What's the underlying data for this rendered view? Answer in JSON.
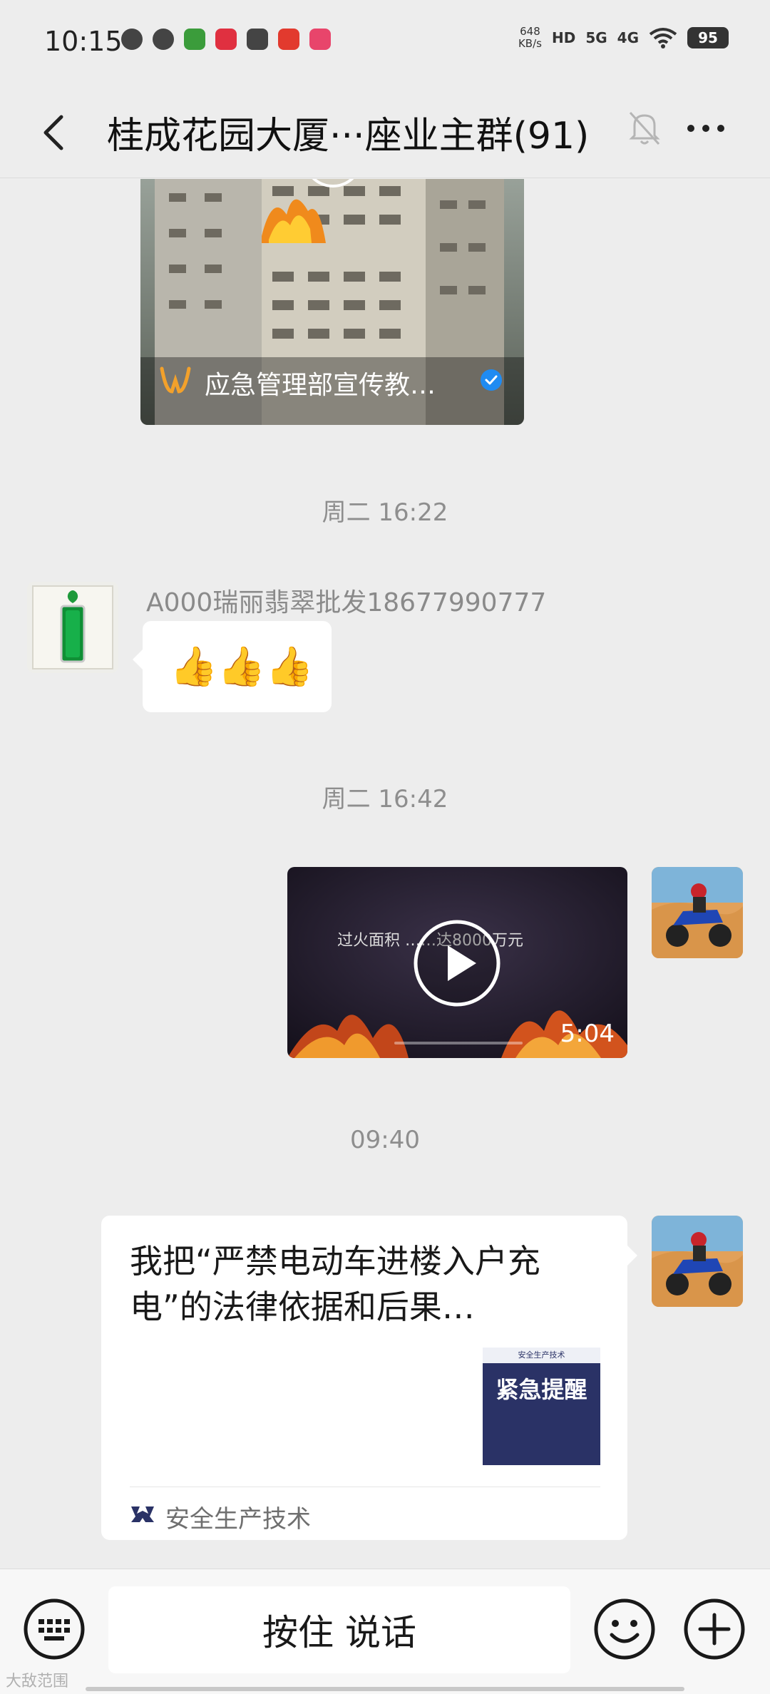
{
  "status_bar": {
    "time": "10:15",
    "net_speed_value": "648",
    "net_speed_unit": "KB/s",
    "hd_label": "HD",
    "signal_5g": "5G",
    "signal_4g": "4G",
    "battery": "95"
  },
  "header": {
    "title": "桂成花园大厦···座业主群(91)",
    "back_icon": "chevron-left-icon",
    "mute_icon": "bell-off-icon",
    "more_icon": "more-dots-icon"
  },
  "messages": {
    "top_image": {
      "channel_label": "应急管理部宣传教…"
    },
    "time_1": "周二 16:22",
    "msg_1": {
      "sender": "A000瑞丽翡翠批发18677990777",
      "content": "👍👍👍"
    },
    "time_2": "周二 16:42",
    "video": {
      "duration": "5:04",
      "caption": "过火面积 ……达8000万元"
    },
    "time_3": "09:40",
    "article": {
      "title": "我把“严禁电动车进楼入户充电”的法律依据和后果…",
      "thumb_header": "安全生产技术",
      "thumb_text": "紧急提醒",
      "source": "安全生产技术"
    }
  },
  "input_bar": {
    "hold_to_talk": "按住 说话",
    "keyboard_icon": "keyboard-icon",
    "emoji_icon": "smiley-icon",
    "plus_icon": "plus-circle-icon"
  },
  "watermark": "大敌范围",
  "colors": {
    "background": "#ededed",
    "bubble": "#ffffff",
    "timestamp": "#8e8e8e",
    "verified_blue": "#1f8bf2"
  }
}
